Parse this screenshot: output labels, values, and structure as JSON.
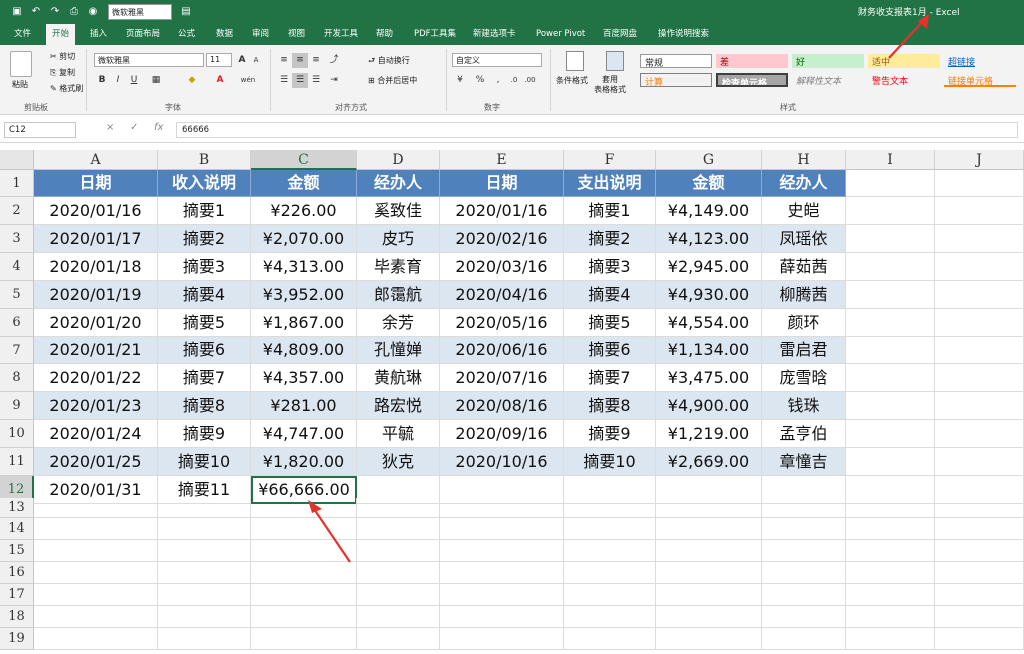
{
  "titlebar": {
    "title": "财务收支报表1月 - Excel",
    "font_box": "微软雅黑",
    "icons": [
      "save-icon",
      "undo-icon",
      "redo-icon",
      "print-preview-icon",
      "camera-icon",
      "paste-special-icon"
    ]
  },
  "tabs": [
    "文件",
    "开始",
    "插入",
    "页面布局",
    "公式",
    "数据",
    "审阅",
    "视图",
    "开发工具",
    "帮助",
    "PDF工具集",
    "新建选项卡",
    "Power Pivot",
    "百度网盘",
    "操作说明搜索"
  ],
  "active_tab": "开始",
  "ribbon": {
    "clipboard": {
      "paste": "粘贴",
      "cut": "剪切",
      "copy": "复制",
      "format_painter": "格式刷",
      "label": "剪贴板"
    },
    "font": {
      "name": "微软雅黑",
      "size": "11",
      "bold": "B",
      "italic": "I",
      "underline": "U",
      "grow": "A",
      "shrink": "A",
      "wen": "wén",
      "label": "字体"
    },
    "alignment": {
      "wrap": "自动换行",
      "merge": "合并后居中",
      "label": "对齐方式"
    },
    "number": {
      "format": "自定义",
      "label": "数字"
    },
    "styles": {
      "conditional": "条件格式",
      "table": "套用\n表格格式",
      "label": "样式",
      "cells": [
        "常规",
        "差",
        "好",
        "适中",
        "超链接",
        "计算",
        "检查单元格",
        "解释性文本",
        "警告文本",
        "链接单元格"
      ]
    }
  },
  "formula_bar": {
    "name_box": "C12",
    "cancel": "×",
    "enter": "✓",
    "fx": "fx",
    "value": "66666"
  },
  "columns": [
    "A",
    "B",
    "C",
    "D",
    "E",
    "F",
    "G",
    "H",
    "I",
    "J"
  ],
  "rows": [
    "1",
    "2",
    "3",
    "4",
    "5",
    "6",
    "7",
    "8",
    "9",
    "10",
    "11",
    "12",
    "13",
    "14",
    "15",
    "16",
    "17",
    "18",
    "19"
  ],
  "selected_cell": "C12",
  "table": {
    "headers": [
      "日期",
      "收入说明",
      "金额",
      "经办人",
      "日期",
      "支出说明",
      "金额",
      "经办人"
    ],
    "rows": [
      [
        "2020/01/16",
        "摘要1",
        "¥226.00",
        "奚致佳",
        "2020/01/16",
        "摘要1",
        "¥4,149.00",
        "史皑"
      ],
      [
        "2020/01/17",
        "摘要2",
        "¥2,070.00",
        "皮巧",
        "2020/02/16",
        "摘要2",
        "¥4,123.00",
        "凤瑶依"
      ],
      [
        "2020/01/18",
        "摘要3",
        "¥4,313.00",
        "毕素育",
        "2020/03/16",
        "摘要3",
        "¥2,945.00",
        "薛茹茜"
      ],
      [
        "2020/01/19",
        "摘要4",
        "¥3,952.00",
        "郎霭航",
        "2020/04/16",
        "摘要4",
        "¥4,930.00",
        "柳腾茜"
      ],
      [
        "2020/01/20",
        "摘要5",
        "¥1,867.00",
        "余芳",
        "2020/05/16",
        "摘要5",
        "¥4,554.00",
        "颜环"
      ],
      [
        "2020/01/21",
        "摘要6",
        "¥4,809.00",
        "孔憧婵",
        "2020/06/16",
        "摘要6",
        "¥1,134.00",
        "雷启君"
      ],
      [
        "2020/01/22",
        "摘要7",
        "¥4,357.00",
        "黄航琳",
        "2020/07/16",
        "摘要7",
        "¥3,475.00",
        "庞雪晗"
      ],
      [
        "2020/01/23",
        "摘要8",
        "¥281.00",
        "路宏悦",
        "2020/08/16",
        "摘要8",
        "¥4,900.00",
        "钱珠"
      ],
      [
        "2020/01/24",
        "摘要9",
        "¥4,747.00",
        "平毓",
        "2020/09/16",
        "摘要9",
        "¥1,219.00",
        "孟亨伯"
      ],
      [
        "2020/01/25",
        "摘要10",
        "¥1,820.00",
        "狄克",
        "2020/10/16",
        "摘要10",
        "¥2,669.00",
        "章憧吉"
      ],
      [
        "2020/01/31",
        "摘要11",
        "¥66,666.00",
        "",
        "",
        "",
        "",
        ""
      ]
    ]
  },
  "colors": {
    "excel_green": "#217346",
    "header_blue": "#4f81bd",
    "band_blue": "#dce6f1",
    "annotation_red": "#e8302a"
  }
}
